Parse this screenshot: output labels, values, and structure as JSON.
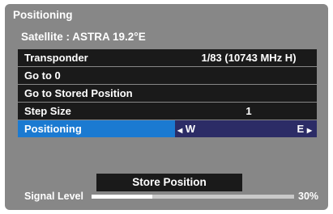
{
  "window": {
    "title": "Positioning"
  },
  "satellite": {
    "text": "Satellite : ASTRA 19.2°E"
  },
  "menu": {
    "items": [
      {
        "label": "Transponder",
        "value": "1/83 (10743 MHz  H)"
      },
      {
        "label": "Go to 0",
        "value": ""
      },
      {
        "label": "Go to Stored Position",
        "value": ""
      },
      {
        "label": "Step Size",
        "value": "1"
      },
      {
        "label": "Positioning",
        "left_text": "W",
        "right_text": "E",
        "left_arrow": "◀",
        "right_arrow": "▶"
      }
    ]
  },
  "store_button": {
    "label": "Store Position"
  },
  "signal": {
    "label": "Signal Level",
    "percent_text": "30%",
    "level": 0.3
  },
  "colors": {
    "panel": "#878787",
    "row": "#1a1a1a",
    "highlight": "#1b7ad1",
    "selected_value_bg": "#2c2c66"
  }
}
